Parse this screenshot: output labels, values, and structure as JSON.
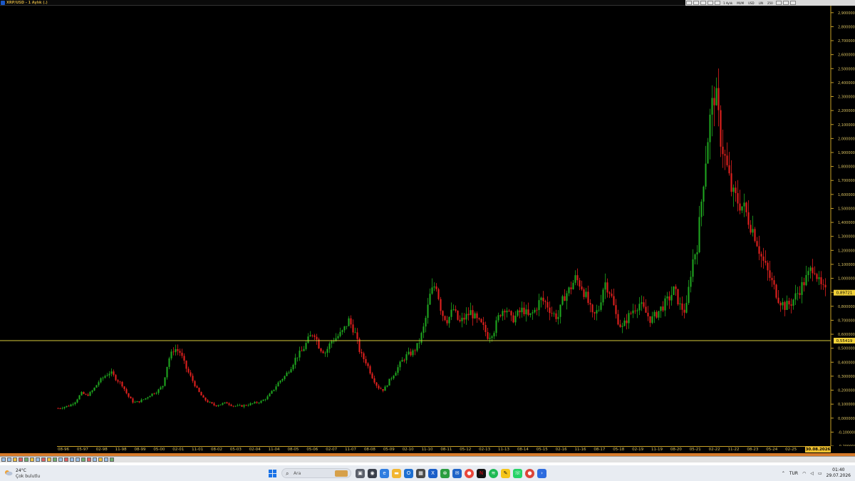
{
  "window": {
    "title": "XRP/USD - 1 Aylık (.)",
    "toolbar_items": [
      "1 Aylık",
      "MUM",
      "USD",
      "LIN",
      "250"
    ]
  },
  "chart_data": {
    "type": "candlestick",
    "title": "",
    "y_axis": {
      "ticks": [
        "2,900000",
        "2,800000",
        "2,700000",
        "2,600000",
        "2,500000",
        "2,400000",
        "2,300000",
        "2,200000",
        "2,100000",
        "2,000000",
        "1,900000",
        "1,800000",
        "1,700000",
        "1,600000",
        "1,500000",
        "1,400000",
        "1,300000",
        "1,200000",
        "1,100000",
        "1,000000",
        "0,900000",
        "0,800000",
        "0,700000",
        "0,600000",
        "0,500000",
        "0,400000",
        "0,300000",
        "0,200000",
        "0,100000",
        "0,000000",
        "-0,100000",
        "-0,200000"
      ],
      "range": [
        -0.2,
        2.95
      ],
      "position": "right"
    },
    "x_axis": {
      "ticks": [
        "08-96",
        "05-97",
        "02-98",
        "11-98",
        "08-99",
        "05-00",
        "02-01",
        "11-01",
        "08-02",
        "05-03",
        "02-04",
        "11-04",
        "08-05",
        "05-06",
        "02-07",
        "11-07",
        "08-08",
        "05-09",
        "02-10",
        "11-10",
        "08-11",
        "05-12",
        "02-13",
        "11-13",
        "08-14",
        "05-15",
        "02-16",
        "11-16",
        "08-17",
        "05-18",
        "02-19",
        "11-19",
        "08-20",
        "05-21",
        "02-22",
        "11-22",
        "08-23",
        "05-24",
        "02-25"
      ],
      "current_date": "30.08.2026"
    },
    "current_price_label": "0,89721",
    "current_price": 0.89721,
    "horizontal_line_label": "0,55419",
    "horizontal_line": 0.55419,
    "series": [
      {
        "values": [
          0.07,
          0.08,
          0.09,
          0.12,
          0.18,
          0.16,
          0.2,
          0.26,
          0.3,
          0.33,
          0.28,
          0.24,
          0.16,
          0.11,
          0.12,
          0.14,
          0.17,
          0.19,
          0.23,
          0.42,
          0.5,
          0.47,
          0.36,
          0.28,
          0.2,
          0.14,
          0.11,
          0.09,
          0.1,
          0.11,
          0.09,
          0.085,
          0.09,
          0.1,
          0.11,
          0.12,
          0.15,
          0.2,
          0.26,
          0.3,
          0.36,
          0.44,
          0.48,
          0.56,
          0.62,
          0.5,
          0.47,
          0.55,
          0.58,
          0.62,
          0.7,
          0.62,
          0.46,
          0.4,
          0.3,
          0.22,
          0.2,
          0.27,
          0.33,
          0.4,
          0.45,
          0.47,
          0.53,
          0.66,
          0.88,
          0.97,
          0.75,
          0.7,
          0.78,
          0.68,
          0.72,
          0.76,
          0.7,
          0.66,
          0.58,
          0.63,
          0.75,
          0.8,
          0.7,
          0.74,
          0.78,
          0.72,
          0.77,
          0.85,
          0.82,
          0.75,
          0.72,
          0.87,
          0.92,
          1.0,
          0.95,
          0.85,
          0.72,
          0.78,
          0.98,
          0.9,
          0.73,
          0.64,
          0.72,
          0.78,
          0.82,
          0.76,
          0.7,
          0.75,
          0.8,
          0.85,
          0.92,
          0.8,
          0.76,
          1.1,
          1.25,
          1.7,
          2.1,
          2.35,
          2.0,
          1.8,
          1.6,
          1.55,
          1.5,
          1.4,
          1.3,
          1.15,
          1.05,
          0.95,
          0.85,
          0.8,
          0.82,
          0.88,
          0.95,
          1.02,
          1.1,
          0.95,
          0.9
        ]
      }
    ]
  },
  "taskbar": {
    "weather_temp": "24°C",
    "weather_condition": "Çok bulutlu",
    "search_placeholder": "Ara",
    "language": "TUR",
    "time": "01:40",
    "date": "29.07.2026",
    "icons": [
      "start",
      "search",
      "task-view",
      "widgets",
      "edge",
      "file-explorer",
      "outlook",
      "microsoft-store",
      "excel",
      "xbox",
      "mail",
      "chrome",
      "netflix",
      "spotify",
      "sticky",
      "whatsapp",
      "chrome-profile",
      "terminal"
    ]
  }
}
